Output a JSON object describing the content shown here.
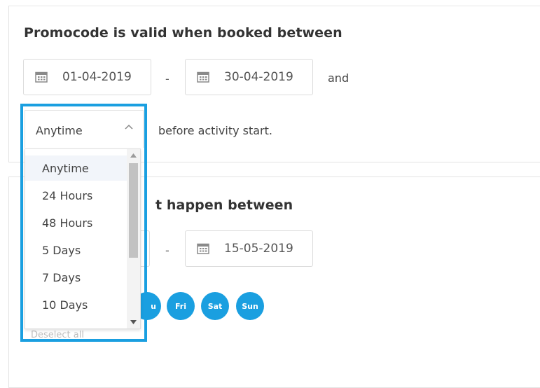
{
  "booking": {
    "title": "Promocode is valid when booked between",
    "start_date": "01-04-2019",
    "end_date": "30-04-2019",
    "separator": "-",
    "and_label": "and",
    "before_label": "before activity start."
  },
  "activity": {
    "title_visible": "t happen between",
    "end_date": "15-05-2019",
    "separator": "-",
    "days": [
      "u",
      "Fri",
      "Sat",
      "Sun"
    ]
  },
  "dropdown": {
    "selected": "Anytime",
    "options": [
      "Anytime",
      "24 Hours",
      "48 Hours",
      "5 Days",
      "7 Days",
      "10 Days"
    ],
    "highlighted_index": 0
  },
  "deselect_label": "Deselect all",
  "colors": {
    "accent": "#1a9fe0",
    "text": "#444444",
    "border": "#dcdcdc"
  }
}
